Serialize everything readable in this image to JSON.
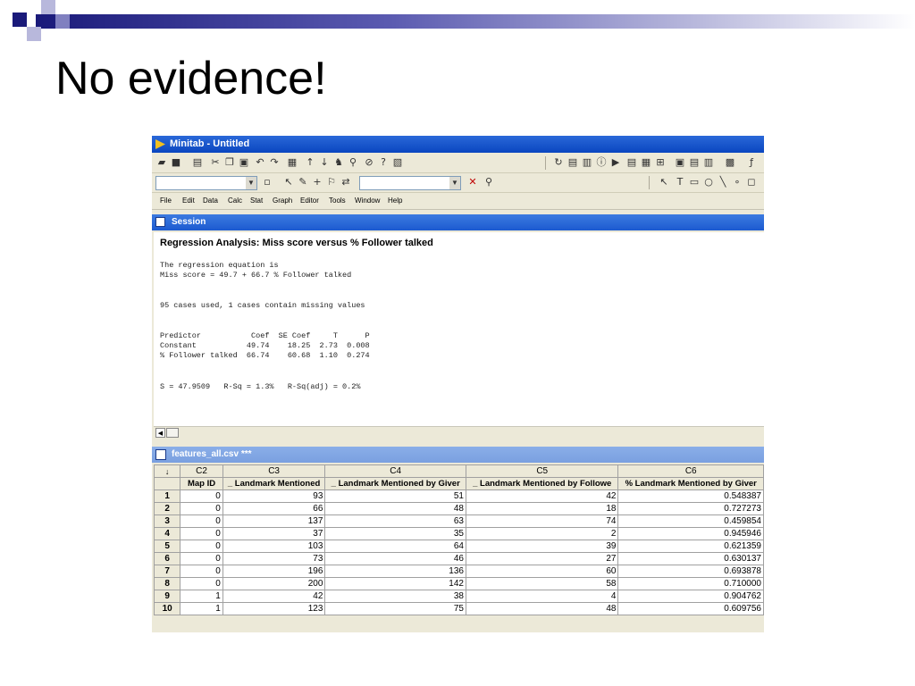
{
  "slide": {
    "title": "No evidence!"
  },
  "app": {
    "title": "Minitab - Untitled",
    "menu": [
      "File",
      "Edit",
      "Data",
      "Calc",
      "Stat",
      "Graph",
      "Editor",
      "Tools",
      "Window",
      "Help"
    ]
  },
  "session": {
    "title": "Session",
    "heading": "Regression Analysis: Miss score versus % Follower talked",
    "equation_label": "The regression equation is",
    "equation": "Miss score = 49.7 + 66.7 % Follower talked",
    "cases": "95 cases used, 1 cases contain missing values",
    "coef_header": "Predictor           Coef  SE Coef     T      P",
    "coef_rows": [
      "Constant           49.74    18.25  2.73  0.008",
      "% Follower talked  66.74    60.68  1.10  0.274"
    ],
    "stats": "S = 47.9509   R-Sq = 1.3%   R-Sq(adj) = 0.2%"
  },
  "worksheet": {
    "title": "features_all.csv ***",
    "corner": "↓",
    "columns": [
      "C2",
      "C3",
      "C4",
      "C5",
      "C6"
    ],
    "names": [
      "Map ID",
      "_ Landmark Mentioned",
      "_ Landmark Mentioned by Giver",
      "_ Landmark Mentioned by Followe",
      "% Landmark Mentioned by Giver"
    ],
    "rows": [
      {
        "n": "1",
        "c2": "0",
        "c3": "93",
        "c4": "51",
        "c5": "42",
        "c6": "0.548387"
      },
      {
        "n": "2",
        "c2": "0",
        "c3": "66",
        "c4": "48",
        "c5": "18",
        "c6": "0.727273"
      },
      {
        "n": "3",
        "c2": "0",
        "c3": "137",
        "c4": "63",
        "c5": "74",
        "c6": "0.459854"
      },
      {
        "n": "4",
        "c2": "0",
        "c3": "37",
        "c4": "35",
        "c5": "2",
        "c6": "0.945946"
      },
      {
        "n": "5",
        "c2": "0",
        "c3": "103",
        "c4": "64",
        "c5": "39",
        "c6": "0.621359"
      },
      {
        "n": "6",
        "c2": "0",
        "c3": "73",
        "c4": "46",
        "c5": "27",
        "c6": "0.630137"
      },
      {
        "n": "7",
        "c2": "0",
        "c3": "196",
        "c4": "136",
        "c5": "60",
        "c6": "0.693878"
      },
      {
        "n": "8",
        "c2": "0",
        "c3": "200",
        "c4": "142",
        "c5": "58",
        "c6": "0.710000"
      },
      {
        "n": "9",
        "c2": "1",
        "c3": "42",
        "c4": "38",
        "c5": "4",
        "c6": "0.904762"
      },
      {
        "n": "10",
        "c2": "1",
        "c3": "123",
        "c4": "75",
        "c5": "48",
        "c6": "0.609756"
      }
    ]
  }
}
